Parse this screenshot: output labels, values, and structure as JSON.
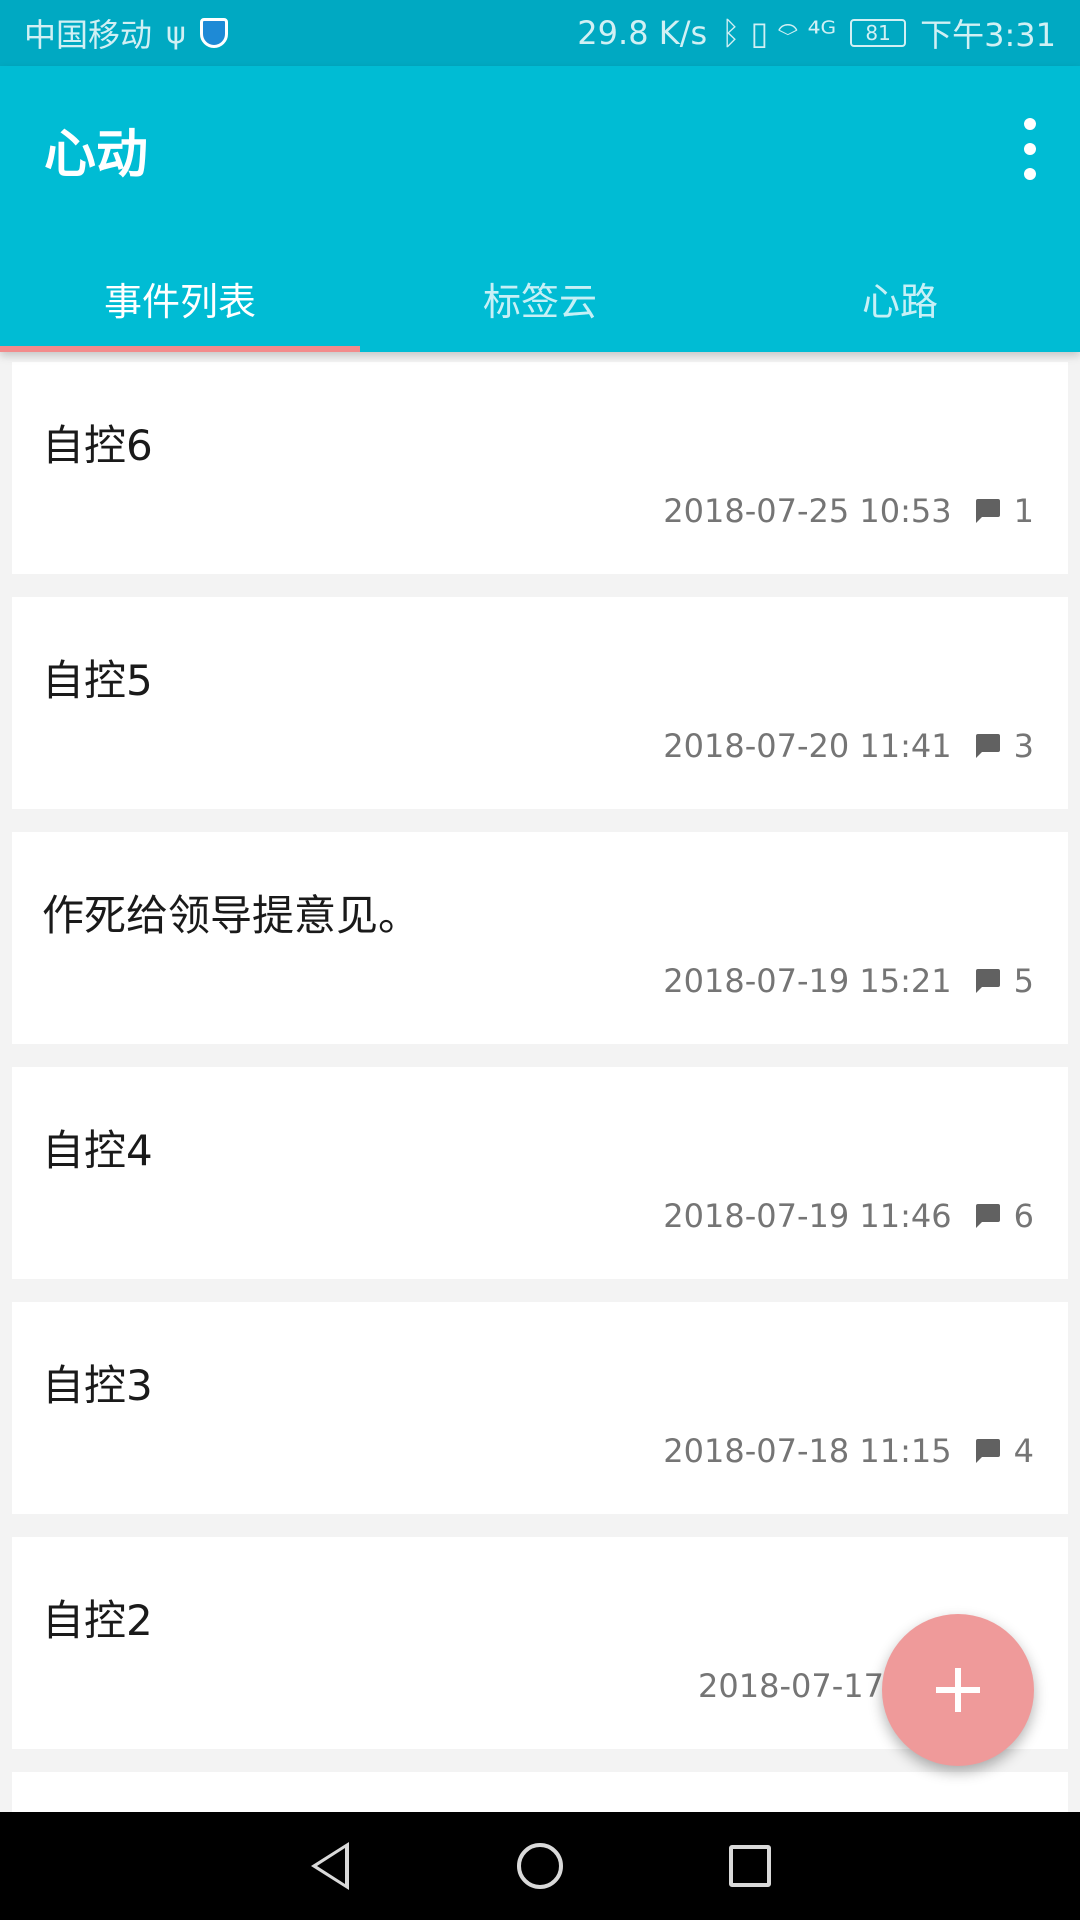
{
  "status_bar": {
    "carrier": "中国移动",
    "usb_symbol": "ψ",
    "speed": "29.8 K/s",
    "signal_text": "ᛒ ▯ ⌔ ⁴ᴳ",
    "battery": "81",
    "time": "下午3:31"
  },
  "app_bar": {
    "title": "心动"
  },
  "tabs": [
    {
      "label": "事件列表",
      "active": true
    },
    {
      "label": "标签云",
      "active": false
    },
    {
      "label": "心路",
      "active": false
    }
  ],
  "events": [
    {
      "title": "自控6",
      "datetime": "2018-07-25 10:53",
      "comments": "1"
    },
    {
      "title": "自控5",
      "datetime": "2018-07-20 11:41",
      "comments": "3"
    },
    {
      "title": "作死给领导提意见。",
      "datetime": "2018-07-19 15:21",
      "comments": "5"
    },
    {
      "title": "自控4",
      "datetime": "2018-07-19 11:46",
      "comments": "6"
    },
    {
      "title": "自控3",
      "datetime": "2018-07-18 11:15",
      "comments": "4"
    },
    {
      "title": "自控2",
      "datetime": "2018-07-17 1",
      "comments": ""
    }
  ],
  "colors": {
    "primary": "#00bcd4",
    "status_bar": "#00a9c2",
    "accent": "#ef9a9a",
    "tab_indicator": "#f28b8b"
  }
}
